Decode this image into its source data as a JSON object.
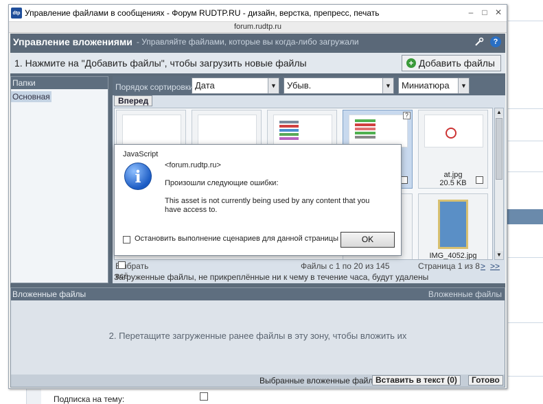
{
  "window": {
    "title": "Управление файлами в сообщениях - Форум RUDTP.RU - дизайн, верстка, препресс, печать",
    "url": "forum.rudtp.ru",
    "app_icon": "dtp",
    "controls": [
      "–",
      "□",
      "✕"
    ]
  },
  "header": {
    "title": "Управление вложениями",
    "subtitle": "- Управляйте файлами, которые вы когда-либо загружали"
  },
  "step1": {
    "text": "1. Нажмите на \"Добавить файлы\", чтобы загрузить новые файлы",
    "add_button": "Добавить файлы"
  },
  "folders": {
    "title": "Папки",
    "items": [
      "Основная"
    ]
  },
  "sort": {
    "label": "Порядок сортировки:",
    "field": "Дата",
    "direction": "Убыв.",
    "view": "Миниатюра",
    "forward": "Вперед"
  },
  "files": [
    {
      "name": "",
      "size": ""
    },
    {
      "name": "",
      "size": ""
    },
    {
      "name": "",
      "size": ""
    },
    {
      "name": "",
      "size": ""
    },
    {
      "name": "at.jpg",
      "size": "20.5 KB"
    },
    {
      "name": "IMG_4052.jpg",
      "size": ""
    }
  ],
  "pager": {
    "select_all": "Выбрать всё",
    "files_range": "Файлы с 1 по 20 из 145",
    "page": "Страница 1 из 8",
    "next": ">",
    "last": ">>"
  },
  "notice": "Загруженные файлы, не прикреплённые ни к чему в течение часа, будут удалены",
  "attached": {
    "title": "Вложенные файлы",
    "title_right": "Вложенные файлы",
    "drop_hint": "2. Перетащите загруженные ранее файлы в эту зону, чтобы вложить их",
    "footer_label": "Выбранные вложенные файлы:",
    "insert_button": "Вставить в текст (0)",
    "done_button": "Готово"
  },
  "dialog": {
    "title": "JavaScript",
    "origin": "<forum.rudtp.ru>",
    "line1": "Произошли следующие ошибки:",
    "line2": "This asset is not currently being used by any content that you",
    "line3": "have access to.",
    "checkbox_label": "Остановить выполнение сценариев для данной страницы",
    "ok": "OK"
  },
  "background": {
    "subscribe_label": "Подписка на тему:"
  }
}
